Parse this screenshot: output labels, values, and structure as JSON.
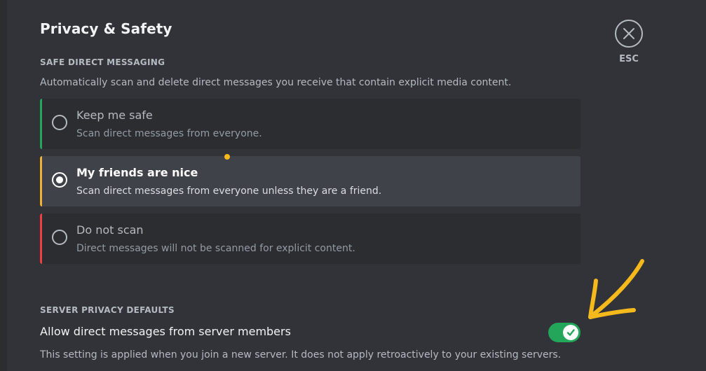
{
  "page": {
    "title": "Privacy & Safety"
  },
  "close": {
    "esc_label": "ESC"
  },
  "safe_dm": {
    "section_title": "SAFE DIRECT MESSAGING",
    "description": "Automatically scan and delete direct messages you receive that contain explicit media content.",
    "options": [
      {
        "title": "Keep me safe",
        "description": "Scan direct messages from everyone.",
        "accent_color": "#23a55a",
        "selected": false
      },
      {
        "title": "My friends are nice",
        "description": "Scan direct messages from everyone unless they are a friend.",
        "accent_color": "#f0b232",
        "selected": true
      },
      {
        "title": "Do not scan",
        "description": "Direct messages will not be scanned for explicit content.",
        "accent_color": "#f23f43",
        "selected": false
      }
    ]
  },
  "server_privacy": {
    "section_title": "SERVER PRIVACY DEFAULTS",
    "setting_label": "Allow direct messages from server members",
    "toggle_on": true,
    "note": "This setting is applied when you join a new server. It does not apply retroactively to your existing servers."
  },
  "colors": {
    "background": "#313338",
    "toggle_on": "#23a55a",
    "annotation": "#f5b91c"
  },
  "icons": {
    "close": "close-icon",
    "check": "check-icon",
    "annotation_arrow": "arrow-icon"
  }
}
